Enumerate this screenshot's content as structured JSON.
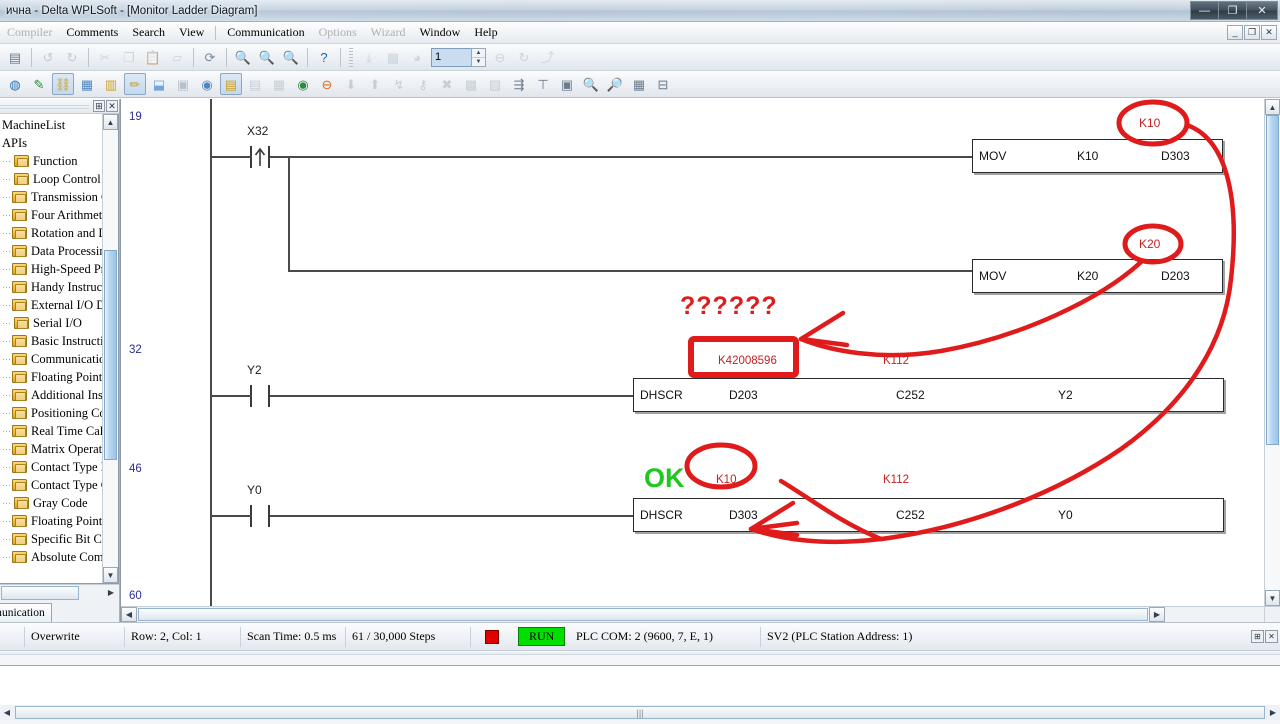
{
  "window": {
    "title": "ична - Delta WPLSoft - [Monitor Ladder Diagram]",
    "minimize": "—",
    "maximize": "❐",
    "close": "✕"
  },
  "mdi_buttons": {
    "minimize": "_",
    "restore": "❐",
    "close": "✕"
  },
  "menubar": {
    "items": [
      {
        "label": "Compiler",
        "disabled": true
      },
      {
        "label": "Comments",
        "disabled": false
      },
      {
        "label": "Search",
        "disabled": false
      },
      {
        "label": "View",
        "disabled": false
      },
      {
        "label": "Communication",
        "disabled": false
      },
      {
        "label": "Options",
        "disabled": true
      },
      {
        "label": "Wizard",
        "disabled": true
      },
      {
        "label": "Window",
        "disabled": false
      },
      {
        "label": "Help",
        "disabled": false
      }
    ]
  },
  "toolbar1": {
    "spinner_value": "1",
    "icons": [
      {
        "name": "new-project-icon",
        "glyph": "▤",
        "color": "#6b7b8b",
        "disabled": false
      },
      {
        "name": "undo-icon",
        "glyph": "↺",
        "color": "#9fb0bf",
        "disabled": true
      },
      {
        "name": "redo-icon",
        "glyph": "↻",
        "color": "#9fb0bf",
        "disabled": true
      },
      {
        "name": "cut-icon",
        "glyph": "✂",
        "color": "#b3bfc9",
        "disabled": true
      },
      {
        "name": "copy-icon",
        "glyph": "❐",
        "color": "#b3bfc9",
        "disabled": true
      },
      {
        "name": "paste-icon",
        "glyph": "📋",
        "color": "#b3bfc9",
        "disabled": true
      },
      {
        "name": "erase-icon",
        "glyph": "▱",
        "color": "#b3bfc9",
        "disabled": true
      },
      {
        "name": "find-device-icon",
        "glyph": "⟳",
        "color": "#7c8c9b",
        "disabled": false
      },
      {
        "name": "zoom-fit-icon",
        "glyph": "🔍",
        "color": "#2a6fb5",
        "disabled": false
      },
      {
        "name": "zoom-in-icon",
        "glyph": "🔍",
        "color": "#4d86c0",
        "disabled": false
      },
      {
        "name": "zoom-out-icon",
        "glyph": "🔍",
        "color": "#4d86c0",
        "disabled": false
      },
      {
        "name": "help-icon",
        "glyph": "?",
        "color": "#1a62ad",
        "disabled": false
      },
      {
        "name": "ladder-row-icon",
        "glyph": "⤓",
        "color": "#b3bfc9",
        "disabled": true
      },
      {
        "name": "ladder-block-icon",
        "glyph": "▩",
        "color": "#b3bfc9",
        "disabled": true
      },
      {
        "name": "clock-icon",
        "glyph": "◕",
        "color": "#b3bfc9",
        "disabled": true
      },
      {
        "name": "delete-row-icon",
        "glyph": "⊖",
        "color": "#b3bfc9",
        "disabled": true
      },
      {
        "name": "refresh-icon",
        "glyph": "↻",
        "color": "#b3bfc9",
        "disabled": true
      },
      {
        "name": "branch-icon",
        "glyph": "⤴",
        "color": "#b3bfc9",
        "disabled": true
      }
    ]
  },
  "toolbar2": {
    "icons": [
      {
        "name": "monitor-icon",
        "glyph": "◍",
        "color": "#2a6fb5",
        "pressed": false
      },
      {
        "name": "edit-comment-icon",
        "glyph": "✎",
        "color": "#2f8a3f",
        "pressed": false
      },
      {
        "name": "ladder-monitor-icon",
        "glyph": "⛓",
        "color": "#c9a227",
        "pressed": true
      },
      {
        "name": "device-table-icon",
        "glyph": "▦",
        "color": "#4d86c0",
        "pressed": false
      },
      {
        "name": "grid-view-icon",
        "glyph": "▥",
        "color": "#c9a227",
        "pressed": false
      },
      {
        "name": "write-plc-icon",
        "glyph": "✏",
        "color": "#c9a227",
        "pressed": true
      },
      {
        "name": "read-plc-icon",
        "glyph": "⬓",
        "color": "#6fa8dc",
        "pressed": false
      },
      {
        "name": "program-compare-icon",
        "glyph": "▣",
        "color": "#b3bfc9",
        "pressed": false
      },
      {
        "name": "plc-status-icon",
        "glyph": "◉",
        "color": "#4d86c0",
        "pressed": false
      },
      {
        "name": "ladder-diagram-icon",
        "glyph": "▤",
        "color": "#c9a227",
        "pressed": true
      },
      {
        "name": "instruction-list-icon",
        "glyph": "▤",
        "color": "#c6ced6",
        "pressed": false
      },
      {
        "name": "sfc-icon",
        "glyph": "▦",
        "color": "#c6ced6",
        "pressed": false
      },
      {
        "name": "run-plc-icon",
        "glyph": "◉",
        "color": "#2f8a3f",
        "pressed": false
      },
      {
        "name": "stop-plc-icon",
        "glyph": "⊖",
        "color": "#e06a1a",
        "pressed": false
      },
      {
        "name": "download-icon",
        "glyph": "⬇",
        "color": "#c6ced6",
        "pressed": false
      },
      {
        "name": "upload-icon",
        "glyph": "⬆",
        "color": "#c6ced6",
        "pressed": false
      },
      {
        "name": "step-run-icon",
        "glyph": "↯",
        "color": "#c6ced6",
        "pressed": false
      },
      {
        "name": "set-password-icon",
        "glyph": "⚷",
        "color": "#c6ced6",
        "pressed": false
      },
      {
        "name": "clear-plc-icon",
        "glyph": "✖",
        "color": "#c6ced6",
        "pressed": false
      },
      {
        "name": "format-plc-icon",
        "glyph": "▩",
        "color": "#c6ced6",
        "pressed": false
      },
      {
        "name": "system-info-icon",
        "glyph": "▨",
        "color": "#c6ced6",
        "pressed": false
      },
      {
        "name": "align-left-icon",
        "glyph": "⇶",
        "color": "#6b7b8b",
        "pressed": false
      },
      {
        "name": "align-top-icon",
        "glyph": "⊤",
        "color": "#6b7b8b",
        "pressed": false
      },
      {
        "name": "print-preview-icon",
        "glyph": "▣",
        "color": "#6b7b8b",
        "pressed": false
      },
      {
        "name": "find-icon",
        "glyph": "🔍",
        "color": "#6b7b8b",
        "pressed": false
      },
      {
        "name": "find-next-icon",
        "glyph": "🔎",
        "color": "#6b7b8b",
        "pressed": false
      },
      {
        "name": "device-monitor-icon",
        "glyph": "▦",
        "color": "#6b7b8b",
        "pressed": false
      },
      {
        "name": "data-table-icon",
        "glyph": "⊟",
        "color": "#6b7b8b",
        "pressed": false
      }
    ]
  },
  "sidebar": {
    "title": "MachineList",
    "subtitle": "APIs",
    "pin_button": "⊞",
    "close_button": "✕",
    "items": [
      {
        "label": "Function"
      },
      {
        "label": "Loop Control"
      },
      {
        "label": "Transmission C"
      },
      {
        "label": "Four Arithmetic"
      },
      {
        "label": "Rotation and Di"
      },
      {
        "label": "Data Processing"
      },
      {
        "label": "High-Speed Pro"
      },
      {
        "label": "Handy Instructi"
      },
      {
        "label": "External I/O Dis"
      },
      {
        "label": "Serial I/O"
      },
      {
        "label": "Basic Instructio"
      },
      {
        "label": "Communication"
      },
      {
        "label": "Floating Point C"
      },
      {
        "label": "Additional Instr"
      },
      {
        "label": "Positioning Con"
      },
      {
        "label": "Real Time Caler"
      },
      {
        "label": "Matrix Operatic"
      },
      {
        "label": "Contact Type L"
      },
      {
        "label": "Contact Type C"
      },
      {
        "label": "Gray Code"
      },
      {
        "label": "Floating Point C"
      },
      {
        "label": "Specific Bit Cor"
      },
      {
        "label": "Absolute Comp"
      }
    ],
    "tab_label": "munication"
  },
  "ladder": {
    "rung_numbers": [
      "19",
      "32",
      "46",
      "60"
    ],
    "rungs": [
      {
        "id": "rung-19",
        "step": "19",
        "contact": {
          "label": "X32",
          "type": "rising-edge"
        },
        "instructions": [
          {
            "mnemonic": "MOV",
            "operands": [
              "K10",
              "D303"
            ]
          },
          {
            "mnemonic": "MOV",
            "operands": [
              "K20",
              "D203"
            ]
          }
        ]
      },
      {
        "id": "rung-32",
        "step": "32",
        "contact": {
          "label": "Y2",
          "type": "normally-open"
        },
        "instructions": [
          {
            "mnemonic": "DHSCR",
            "operands": [
              "D203",
              "C252",
              "Y2"
            ],
            "monitor_values": [
              "K42008596",
              "K112"
            ]
          }
        ]
      },
      {
        "id": "rung-46",
        "step": "46",
        "contact": {
          "label": "Y0",
          "type": "normally-open"
        },
        "instructions": [
          {
            "mnemonic": "DHSCR",
            "operands": [
              "D303",
              "C252",
              "Y0"
            ],
            "monitor_values": [
              "K10",
              "K112"
            ]
          }
        ]
      }
    ],
    "annotations": [
      {
        "name": "annotation-k10-top",
        "text": "K10",
        "color": "#e01b1b"
      },
      {
        "name": "annotation-k20",
        "text": "K20",
        "color": "#e01b1b"
      },
      {
        "name": "annotation-question-marks",
        "text": "??????",
        "color": "#e01b1b"
      },
      {
        "name": "annotation-ok",
        "text": "OK",
        "color": "#1ec81e"
      },
      {
        "name": "annotation-k42008596",
        "text": "K42008596",
        "color": "#e01b1b"
      },
      {
        "name": "annotation-k10-bottom",
        "text": "K10",
        "color": "#e01b1b"
      }
    ]
  },
  "statusbar": {
    "mode": "Overwrite",
    "position": "Row: 2, Col: 1",
    "scan_time": "Scan Time: 0.5 ms",
    "steps": "61 / 30,000 Steps",
    "run_state": "RUN",
    "plc_com": "PLC COM: 2 (9600, 7, E, 1)",
    "station": "SV2 (PLC Station Address: 1)",
    "dock_pin": "⊞",
    "dock_close": "✕"
  },
  "colors": {
    "monitor_red": "#c42222",
    "annotation_red": "#e01b1b",
    "annotation_green": "#1ec81e",
    "rung_number": "#2b2f8f",
    "run_green": "#00e000",
    "stop_red": "#e00000"
  }
}
